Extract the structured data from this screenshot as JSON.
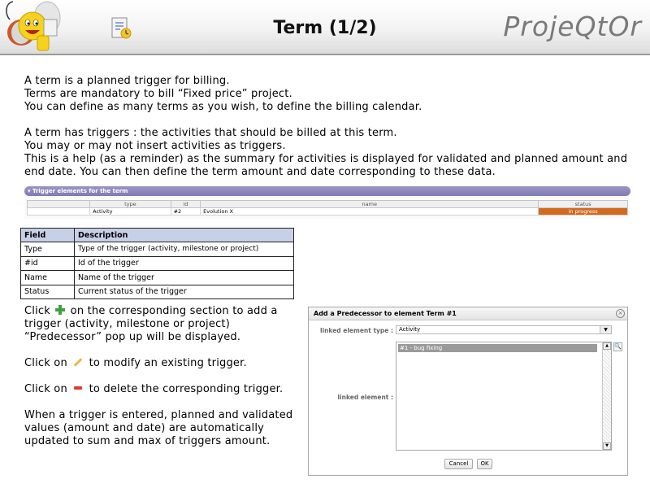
{
  "header": {
    "title": "Term (1/2)",
    "brand": "ProjeQtOr"
  },
  "intro": {
    "p1": "A term is a planned trigger for billing.",
    "p2": "Terms are mandatory to bill “Fixed price” project.",
    "p3": "You can define as many terms as you wish, to define the billing calendar.",
    "p4": "A term has triggers : the activities that should be billed at this term.",
    "p5": "You may or may not insert activities as triggers.",
    "p6": "This is a help (as a reminder) as the summary for activities is displayed for validated and planned amount and end date. You can then define the term amount and date corresponding to these data."
  },
  "trigger_panel": {
    "title": "Trigger elements for the term",
    "columns": [
      "type",
      "id",
      "name",
      "status"
    ],
    "rows": [
      {
        "type": "Activity",
        "id": "#2",
        "name": "Evolution X",
        "status": "in progress"
      }
    ],
    "status_color": "#d2691e"
  },
  "field_table": {
    "headers": [
      "Field",
      "Description"
    ],
    "rows": [
      {
        "field": "Type",
        "description": "Type of the trigger  (activity, milestone or project)"
      },
      {
        "field": "#id",
        "description": "Id of the trigger"
      },
      {
        "field": "Name",
        "description": "Name of the trigger"
      },
      {
        "field": "Status",
        "description": "Current status of the trigger"
      }
    ]
  },
  "lower": {
    "add_pre": "Click",
    "add_post": "on the corresponding section to add a trigger (activity, milestone or project) “Predecessor” pop up will be displayed.",
    "modify_pre": "Click on",
    "modify_post": "to modify an existing trigger.",
    "delete_pre": "Click on",
    "delete_post": "to delete the corresponding trigger.",
    "note": "When a trigger is entered, planned and validated values (amount and date) are automatically updated to sum and max of triggers amount."
  },
  "dialog": {
    "title": "Add a Predecessor to element Term #1",
    "linked_type_label": "linked element type :",
    "linked_type_value": "Activity",
    "linked_element_label": "linked element :",
    "list_items": [
      "#1 - bug fixing"
    ],
    "cancel": "Cancel",
    "ok": "OK"
  },
  "colors": {
    "panel_header": "#8b86bd",
    "table_header": "#c8d0e8",
    "add_icon": "#3fa13f",
    "delete_icon": "#e03b2a"
  }
}
